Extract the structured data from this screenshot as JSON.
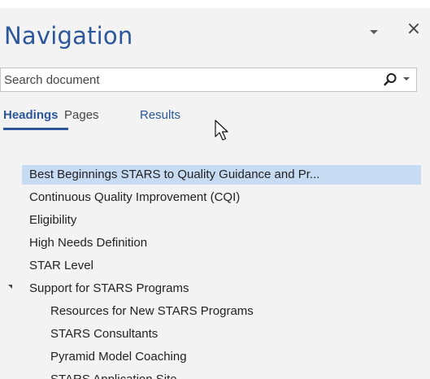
{
  "pane": {
    "title": "Navigation",
    "close_label": "×",
    "icons": {
      "dropdown": "chevron-down-icon",
      "close": "close-icon",
      "search": "search-icon"
    }
  },
  "search": {
    "placeholder": "Search document",
    "value": ""
  },
  "tabs": [
    {
      "label": "Headings",
      "active": true
    },
    {
      "label": "Pages",
      "active": false
    },
    {
      "label": "Results",
      "active": false
    }
  ],
  "headings": [
    {
      "label": "Best Beginnings STARS to Quality  Guidance and Pr...",
      "level": 1,
      "selected": true
    },
    {
      "label": "Continuous Quality Improvement (CQI)",
      "level": 1
    },
    {
      "label": "Eligibility",
      "level": 1
    },
    {
      "label": "High Needs Definition",
      "level": 1
    },
    {
      "label": "STAR Level",
      "level": 1
    },
    {
      "label": "Support for STARS Programs",
      "level": 1,
      "expanded": true
    },
    {
      "label": "Resources for New STARS Programs",
      "level": 2
    },
    {
      "label": "STARS Consultants",
      "level": 2
    },
    {
      "label": "Pyramid Model Coaching",
      "level": 2
    },
    {
      "label": "STARS Application Site",
      "level": 2
    }
  ],
  "colors": {
    "accent": "#2b579a",
    "pane_background": "#f3f3f3",
    "selected_row": "#c7dbf2"
  }
}
